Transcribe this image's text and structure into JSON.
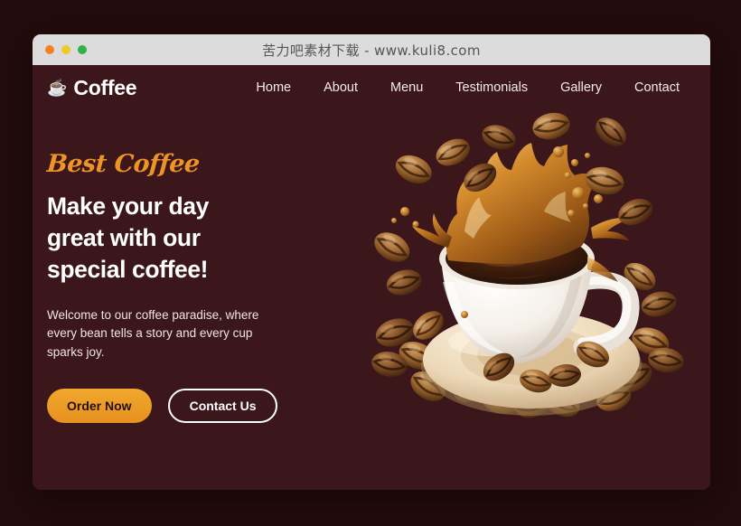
{
  "window": {
    "titlebar": {
      "title": "苦力吧素材下载 - www.kuli8.com",
      "dots": [
        {
          "name": "close-dot",
          "color": "#f58220"
        },
        {
          "name": "minimize-dot",
          "color": "#efc928"
        },
        {
          "name": "maximize-dot",
          "color": "#2fb342"
        }
      ]
    }
  },
  "site": {
    "brand": {
      "icon": "☕",
      "icon_name": "coffee-cup-icon",
      "name": "Coffee"
    },
    "nav": [
      {
        "label": "Home"
      },
      {
        "label": "About"
      },
      {
        "label": "Menu"
      },
      {
        "label": "Testimonials"
      },
      {
        "label": "Gallery"
      },
      {
        "label": "Contact"
      }
    ],
    "hero": {
      "eyebrow": "Best Coffee",
      "headline_line1": "Make your day",
      "headline_line2": "great with our",
      "headline_line3": "special coffee!",
      "subcopy": "Welcome to our coffee paradise, where every bean tells a story and every cup sparks joy.",
      "primary_button": "Order Now",
      "secondary_button": "Contact Us",
      "image_alt": "coffee-cup-splash-with-beans"
    },
    "colors": {
      "page_background": "#230c0b",
      "hero_background": "#3b171b",
      "accent_orange": "#ec9426",
      "button_primary": "#eda125",
      "text_light": "#ffffff",
      "titlebar": "#dcdcdc",
      "titlebar_text": "#555457"
    }
  }
}
